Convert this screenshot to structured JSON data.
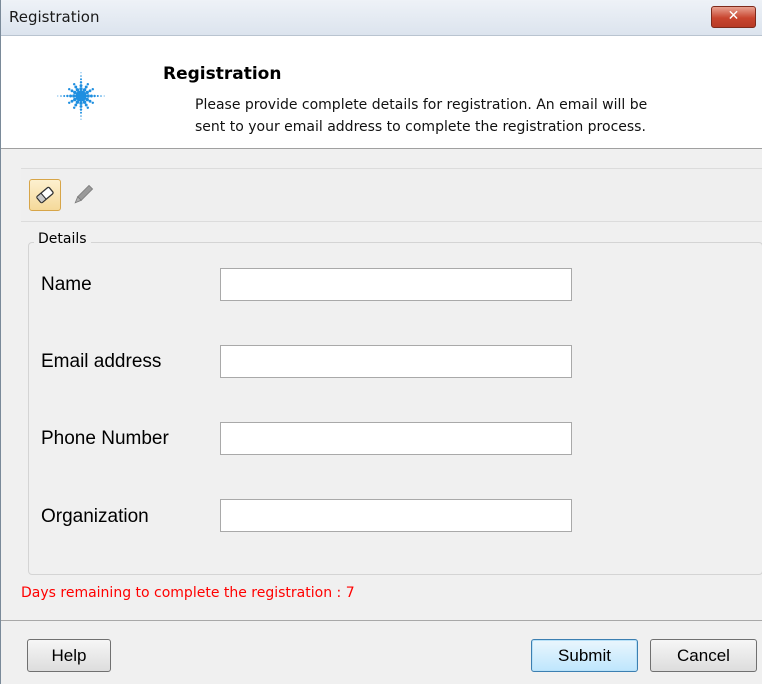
{
  "window": {
    "title": "Registration",
    "close_glyph": "✕"
  },
  "banner": {
    "title": "Registration",
    "description_line1": "Please provide complete details for registration. An email will be",
    "description_line2": "sent to your email address to complete the registration process.",
    "logo_icon": "spark-logo"
  },
  "toolbar": {
    "tools": [
      {
        "icon": "eraser-icon"
      },
      {
        "icon": "pencil-icon"
      }
    ]
  },
  "details": {
    "legend": "Details",
    "fields": [
      {
        "label": "Name",
        "value": ""
      },
      {
        "label": "Email address",
        "value": ""
      },
      {
        "label": "Phone Number",
        "value": ""
      },
      {
        "label": "Organization",
        "value": ""
      }
    ]
  },
  "status": {
    "days_remaining_text": "Days remaining to complete the registration : 7"
  },
  "buttons": {
    "help": "Help",
    "submit": "Submit",
    "cancel": "Cancel"
  },
  "colors": {
    "status_text": "#ff0000",
    "logo": "#1f8fe0",
    "close_button": "#c8452f"
  }
}
